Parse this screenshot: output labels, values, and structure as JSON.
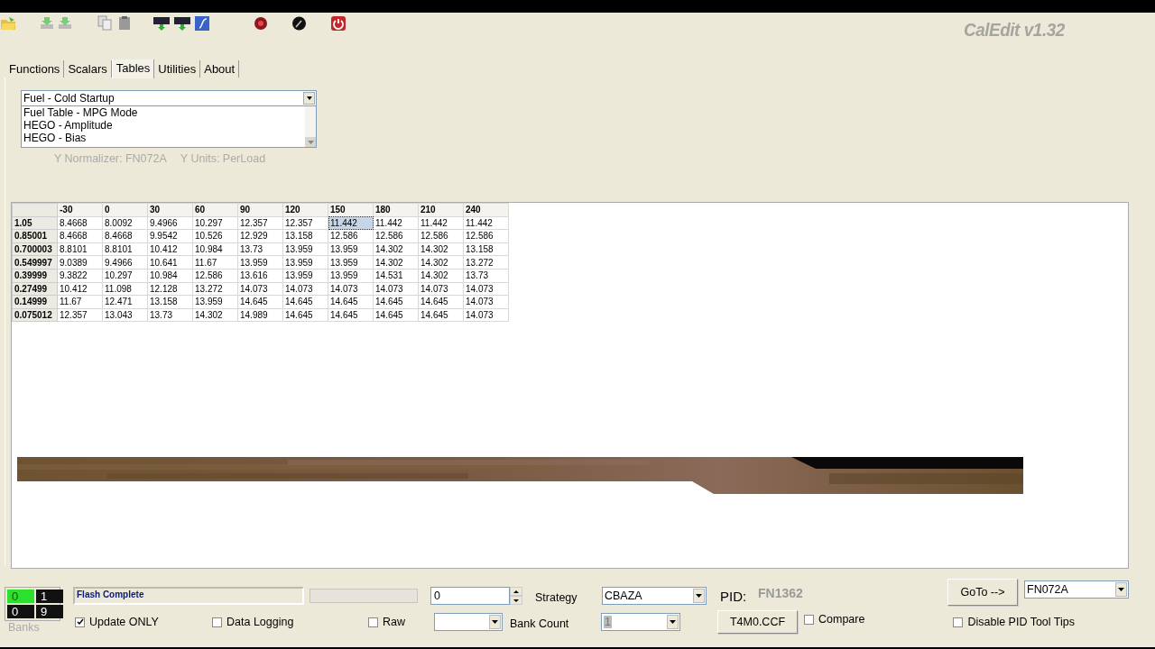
{
  "title": "CalEdit v1.32",
  "tabs": [
    {
      "label": "Functions",
      "selected": false
    },
    {
      "label": "Scalars",
      "selected": false
    },
    {
      "label": "Tables",
      "selected": true
    },
    {
      "label": "Utilities",
      "selected": false
    },
    {
      "label": "About",
      "selected": false
    }
  ],
  "table_list": {
    "value": "Fuel - Cold Startup",
    "items": [
      "Fuel Table - MPG Mode",
      "HEGO - Amplitude",
      "HEGO - Bias"
    ]
  },
  "normalizer_info": [
    "Y Normalizer: FN072A",
    "Y Units: PerLoad"
  ],
  "table": {
    "columns": [
      "-30",
      "0",
      "30",
      "60",
      "90",
      "120",
      "150",
      "180",
      "210",
      "240"
    ],
    "rows": [
      {
        "label": "1.05",
        "cells": [
          {
            "value": "8.4668",
            "selected": false
          },
          {
            "value": "8.0092",
            "selected": false
          },
          {
            "value": "9.4966",
            "selected": false
          },
          {
            "value": "10.297",
            "selected": false
          },
          {
            "value": "12.357",
            "selected": false
          },
          {
            "value": "12.357",
            "selected": false
          },
          {
            "value": "11.442",
            "selected": true
          },
          {
            "value": "11.442",
            "selected": false
          },
          {
            "value": "11.442",
            "selected": false
          },
          {
            "value": "11.442",
            "selected": false
          }
        ]
      },
      {
        "label": "0.85001",
        "cells": [
          {
            "value": "8.4668",
            "selected": false
          },
          {
            "value": "8.4668",
            "selected": false
          },
          {
            "value": "9.9542",
            "selected": false
          },
          {
            "value": "10.526",
            "selected": false
          },
          {
            "value": "12.929",
            "selected": false
          },
          {
            "value": "13.158",
            "selected": false
          },
          {
            "value": "12.586",
            "selected": false
          },
          {
            "value": "12.586",
            "selected": false
          },
          {
            "value": "12.586",
            "selected": false
          },
          {
            "value": "12.586",
            "selected": false
          }
        ]
      },
      {
        "label": "0.700003",
        "cells": [
          {
            "value": "8.8101",
            "selected": false
          },
          {
            "value": "8.8101",
            "selected": false
          },
          {
            "value": "10.412",
            "selected": false
          },
          {
            "value": "10.984",
            "selected": false
          },
          {
            "value": "13.73",
            "selected": false
          },
          {
            "value": "13.959",
            "selected": false
          },
          {
            "value": "13.959",
            "selected": false
          },
          {
            "value": "14.302",
            "selected": false
          },
          {
            "value": "14.302",
            "selected": false
          },
          {
            "value": "13.158",
            "selected": false
          }
        ]
      },
      {
        "label": "0.549997",
        "cells": [
          {
            "value": "9.0389",
            "selected": false
          },
          {
            "value": "9.4966",
            "selected": false
          },
          {
            "value": "10.641",
            "selected": false
          },
          {
            "value": "11.67",
            "selected": false
          },
          {
            "value": "13.959",
            "selected": false
          },
          {
            "value": "13.959",
            "selected": false
          },
          {
            "value": "13.959",
            "selected": false
          },
          {
            "value": "14.302",
            "selected": false
          },
          {
            "value": "14.302",
            "selected": false
          },
          {
            "value": "13.272",
            "selected": false
          }
        ]
      },
      {
        "label": "0.39999",
        "cells": [
          {
            "value": "9.3822",
            "selected": false
          },
          {
            "value": "10.297",
            "selected": false
          },
          {
            "value": "10.984",
            "selected": false
          },
          {
            "value": "12.586",
            "selected": false
          },
          {
            "value": "13.616",
            "selected": false
          },
          {
            "value": "13.959",
            "selected": false
          },
          {
            "value": "13.959",
            "selected": false
          },
          {
            "value": "14.531",
            "selected": false
          },
          {
            "value": "14.302",
            "selected": false
          },
          {
            "value": "13.73",
            "selected": false
          }
        ]
      },
      {
        "label": "0.27499",
        "cells": [
          {
            "value": "10.412",
            "selected": false
          },
          {
            "value": "11.098",
            "selected": false
          },
          {
            "value": "12.128",
            "selected": false
          },
          {
            "value": "13.272",
            "selected": false
          },
          {
            "value": "14.073",
            "selected": false
          },
          {
            "value": "14.073",
            "selected": false
          },
          {
            "value": "14.073",
            "selected": false
          },
          {
            "value": "14.073",
            "selected": false
          },
          {
            "value": "14.073",
            "selected": false
          },
          {
            "value": "14.073",
            "selected": false
          }
        ]
      },
      {
        "label": "0.14999",
        "cells": [
          {
            "value": "11.67",
            "selected": false
          },
          {
            "value": "12.471",
            "selected": false
          },
          {
            "value": "13.158",
            "selected": false
          },
          {
            "value": "13.959",
            "selected": false
          },
          {
            "value": "14.645",
            "selected": false
          },
          {
            "value": "14.645",
            "selected": false
          },
          {
            "value": "14.645",
            "selected": false
          },
          {
            "value": "14.645",
            "selected": false
          },
          {
            "value": "14.645",
            "selected": false
          },
          {
            "value": "14.073",
            "selected": false
          }
        ]
      },
      {
        "label": "0.075012",
        "cells": [
          {
            "value": "12.357",
            "selected": false
          },
          {
            "value": "13.043",
            "selected": false
          },
          {
            "value": "13.73",
            "selected": false
          },
          {
            "value": "14.302",
            "selected": false
          },
          {
            "value": "14.989",
            "selected": false
          },
          {
            "value": "14.645",
            "selected": false
          },
          {
            "value": "14.645",
            "selected": false
          },
          {
            "value": "14.645",
            "selected": false
          },
          {
            "value": "14.645",
            "selected": false
          },
          {
            "value": "14.073",
            "selected": false
          }
        ]
      }
    ]
  },
  "overlay": {
    "kind": "picture"
  },
  "banks": {
    "caption": "Banks",
    "cells": [
      {
        "label": "0",
        "lit": true
      },
      {
        "label": "1",
        "lit": false
      },
      {
        "label": "0",
        "lit": false
      },
      {
        "label": "9",
        "lit": false
      }
    ]
  },
  "status": {
    "message": "Flash Complete",
    "level": 0
  },
  "spin_value": "0",
  "strategy": {
    "label": "Strategy",
    "value": "CBAZA"
  },
  "bank_count": {
    "label": "Bank Count",
    "value": "1"
  },
  "pid": {
    "label": "PID:",
    "value": "FN1362"
  },
  "file_button": "T4M0.CCF",
  "goto": {
    "button": "GoTo -->",
    "value": "FN072A"
  },
  "checkboxes": [
    {
      "label": "Update ONLY",
      "checked": true
    },
    {
      "label": "Data Logging",
      "checked": false
    },
    {
      "label": "Raw",
      "checked": false
    },
    {
      "label": "Compare",
      "checked": false
    },
    {
      "label": "Disable PID Tool Tips",
      "checked": false
    }
  ]
}
